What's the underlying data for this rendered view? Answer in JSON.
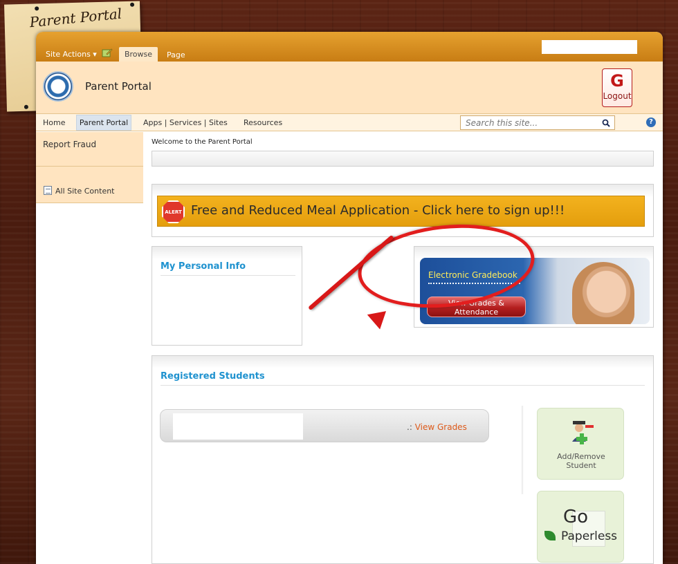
{
  "note": {
    "title": "Parent Portal"
  },
  "ribbon": {
    "site_actions": "Site Actions",
    "tabs": [
      {
        "label": "Browse"
      },
      {
        "label": "Page"
      }
    ]
  },
  "header": {
    "title": "Parent Portal",
    "logout_label": "Logout",
    "logout_glyph": "G"
  },
  "nav": {
    "items": [
      {
        "label": "Home"
      },
      {
        "label": "Parent Portal"
      },
      {
        "label": "Apps | Services | Sites"
      },
      {
        "label": "Resources"
      }
    ],
    "search_placeholder": "Search this site...",
    "help": "?"
  },
  "left_nav": {
    "report_fraud": "Report Fraud",
    "all_site_content": "All Site Content"
  },
  "main": {
    "welcome": "Welcome to the Parent Portal",
    "alert": {
      "badge": "ALERT",
      "text": "Free and Reduced Meal Application - Click here to sign up!!!"
    },
    "personal_info_title": "My Personal Info",
    "gradebook": {
      "title": "Electronic Gradebook",
      "button_line1": "View Grades &",
      "button_line2": "Attendance"
    },
    "registered_students": {
      "title": "Registered Students",
      "prefix": ".:",
      "view_grades": "View Grades"
    },
    "tiles": {
      "add_remove_line1": "Add/Remove",
      "add_remove_line2": "Student",
      "go_line1": "Go",
      "go_line2": "Paperless"
    }
  },
  "colors": {
    "ribbon": "#d38a1b",
    "header_bg": "#ffe4c0",
    "accent_blue": "#1f92cf",
    "alert_banner": "#e9a514",
    "logout_red": "#c21818",
    "link_orange": "#de5a1a"
  }
}
